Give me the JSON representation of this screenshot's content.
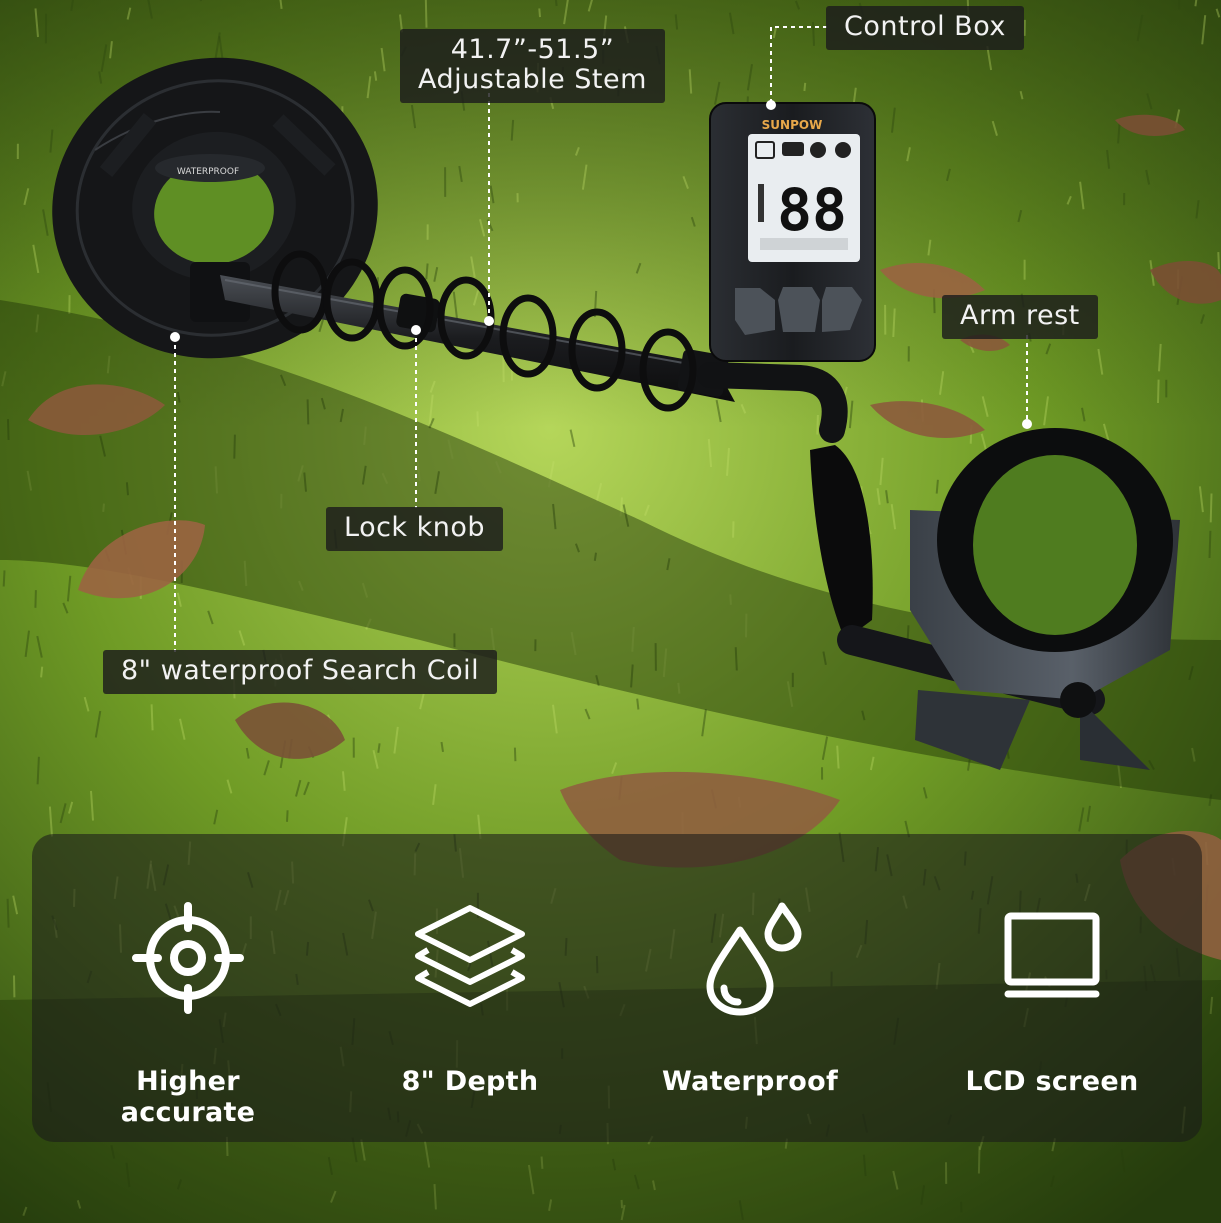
{
  "callouts": {
    "control_box": "Control Box",
    "stem_range": "41.7”-51.5”",
    "stem_label": "Adjustable Stem",
    "arm_rest": "Arm rest",
    "lock_knob": "Lock knob",
    "search_coil": "8\" waterproof Search Coil"
  },
  "device": {
    "brand": "SUNPOW",
    "coil_label": "WATERPROOF",
    "display_digits": "88"
  },
  "features": [
    {
      "label": "Higher accurate",
      "icon": "target-icon"
    },
    {
      "label": "8\" Depth",
      "icon": "layers-icon"
    },
    {
      "label": "Waterproof",
      "icon": "water-drops-icon"
    },
    {
      "label": "LCD screen",
      "icon": "monitor-icon"
    }
  ],
  "colors": {
    "grass": "#5f8f22",
    "grass_light": "#b9d85a",
    "device_body": "#1d1f22",
    "lcd": "#e9edf0",
    "leaf": "#8a5a3a"
  }
}
